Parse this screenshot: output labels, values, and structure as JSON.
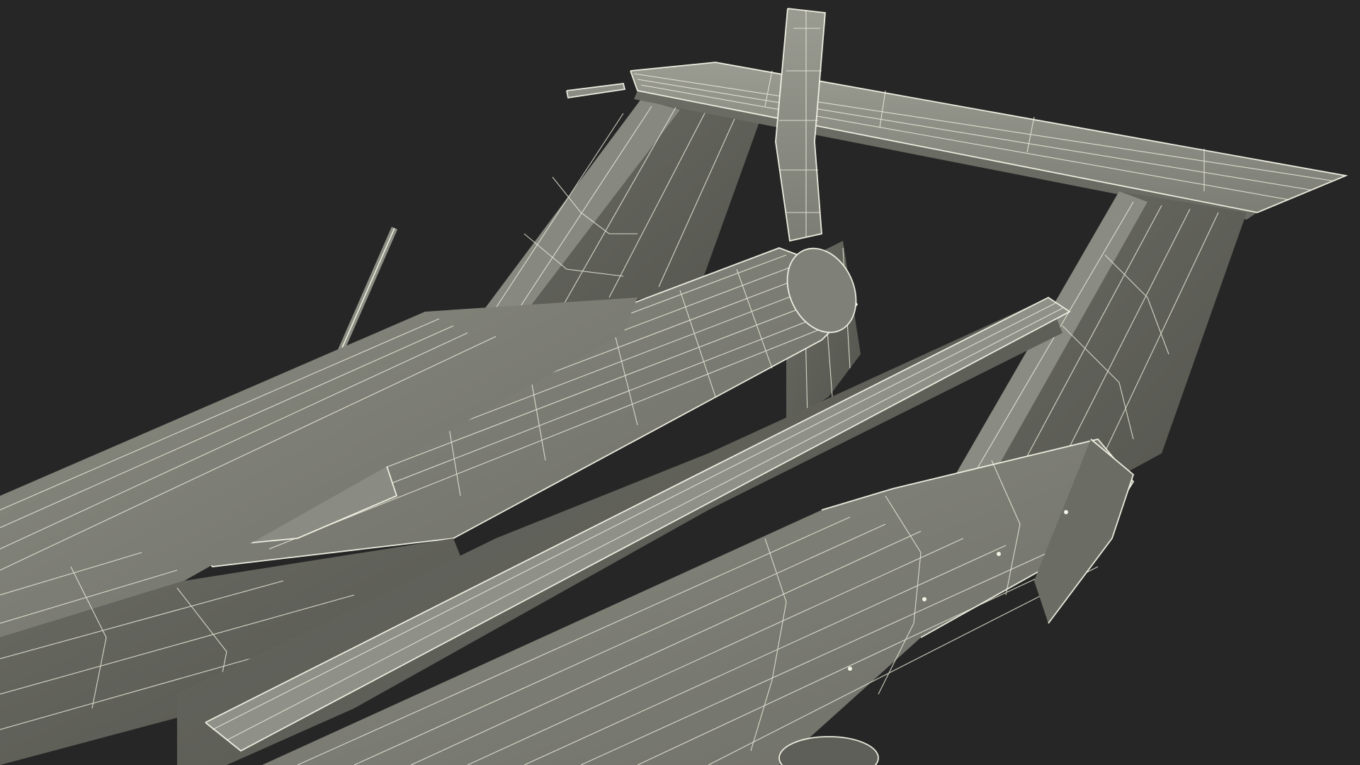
{
  "scene": {
    "background_color": "#262626",
    "surface_color": "#7a7b72",
    "surface_dark_color": "#5f6058",
    "surface_light_color": "#8d8e84",
    "wire_color": "#ececdc",
    "subject": "3d-wireframe-aircraft-tail"
  }
}
